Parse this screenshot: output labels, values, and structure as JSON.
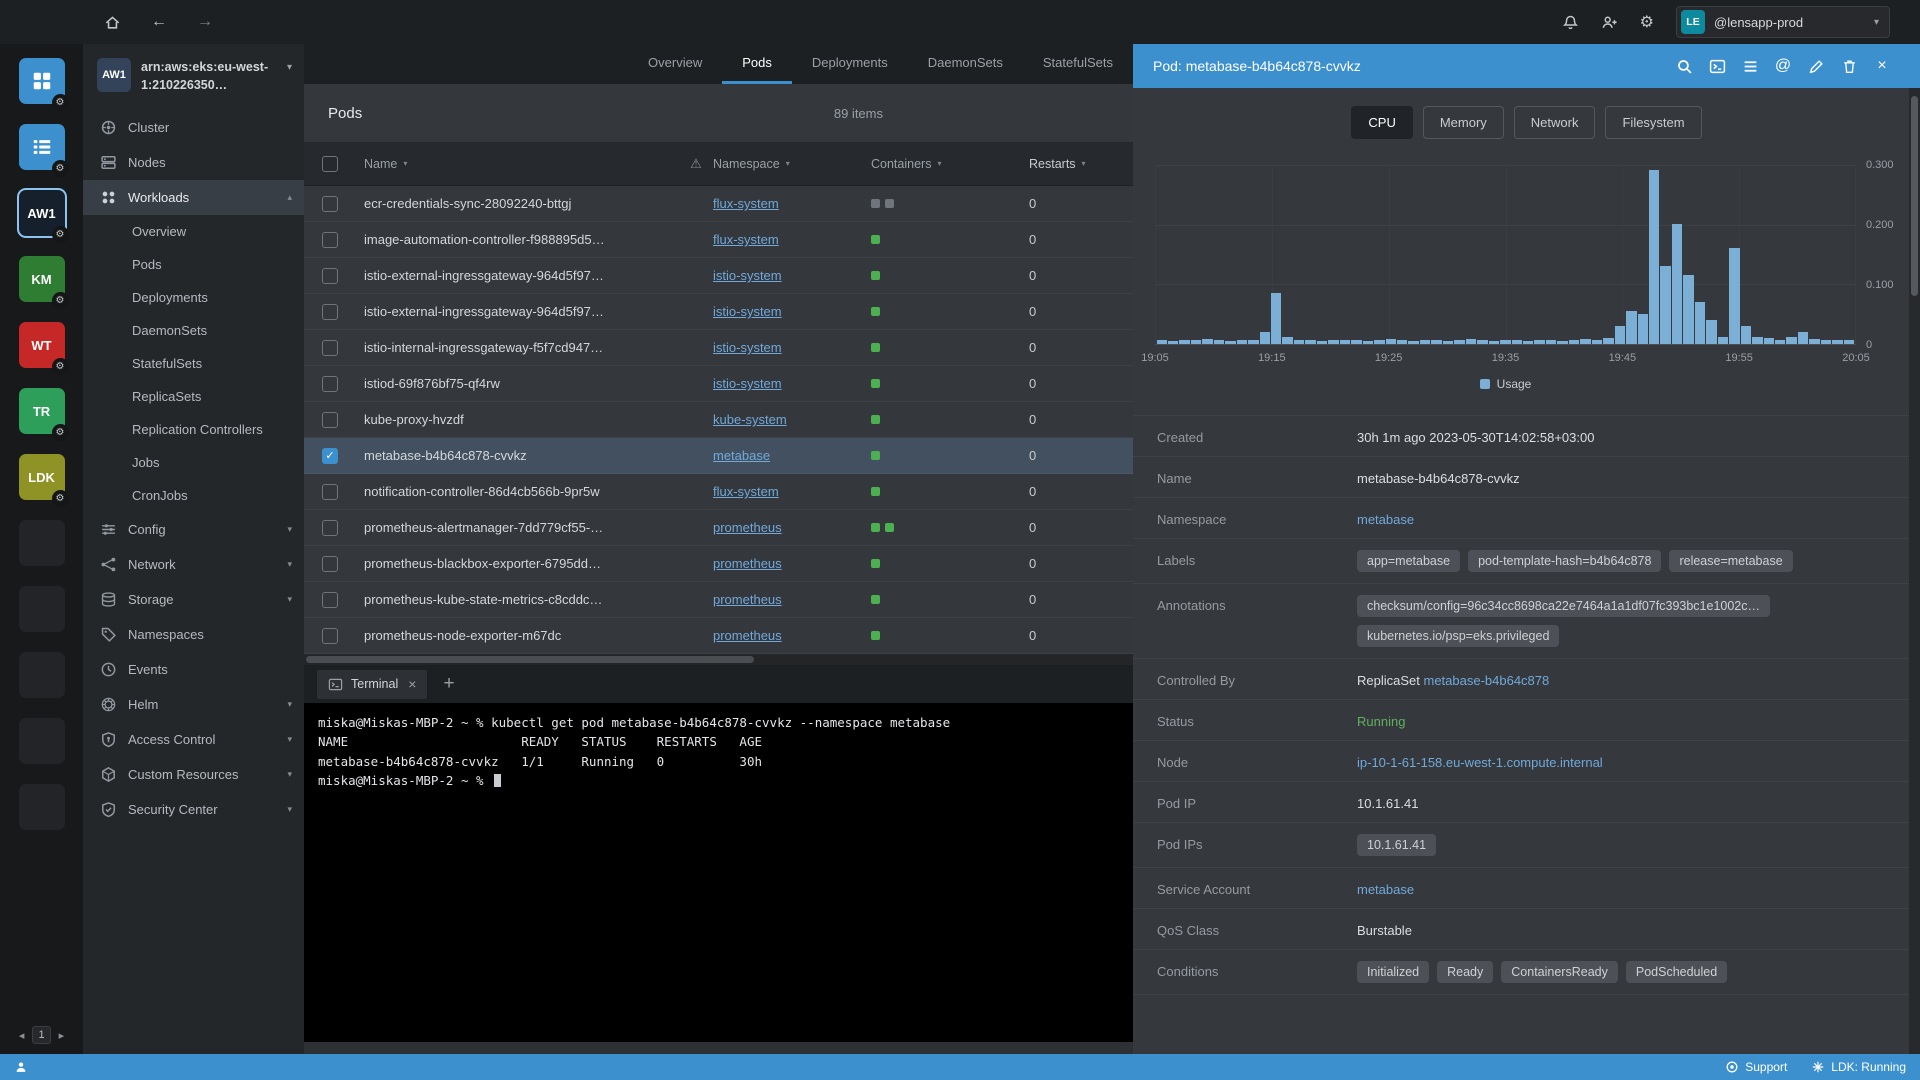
{
  "topbar": {
    "cluster_dropdown": {
      "avatar": "LE",
      "label": "@lensapp-prod"
    }
  },
  "hotbar": {
    "tiles": [
      {
        "id": "catalog",
        "icon": "catalog",
        "color": "#3d90ce"
      },
      {
        "id": "hotbar-menu",
        "icon": "list",
        "color": "#3d90ce"
      },
      {
        "id": "aw1",
        "label": "AW1",
        "color": "#15202c",
        "active": true
      },
      {
        "id": "km",
        "label": "KM",
        "color": "#2e7d32"
      },
      {
        "id": "wt",
        "label": "WT",
        "color": "#c62828"
      },
      {
        "id": "tr",
        "label": "TR",
        "color": "#2e9e5b"
      },
      {
        "id": "ldk",
        "label": "LDK",
        "color": "#8f9225"
      }
    ],
    "empty_slots": 5,
    "page": "1"
  },
  "sidebar": {
    "cluster": {
      "badge": "AW1",
      "name": "arn:aws:eks:eu-west-1:210226350…"
    },
    "active_child": "Pods",
    "items": [
      {
        "label": "Cluster",
        "icon": "cluster"
      },
      {
        "label": "Nodes",
        "icon": "nodes"
      },
      {
        "label": "Workloads",
        "icon": "workloads",
        "expanded": true,
        "active": true,
        "children": [
          "Overview",
          "Pods",
          "Deployments",
          "DaemonSets",
          "StatefulSets",
          "ReplicaSets",
          "Replication Controllers",
          "Jobs",
          "CronJobs"
        ]
      },
      {
        "label": "Config",
        "icon": "config",
        "expandable": true
      },
      {
        "label": "Network",
        "icon": "network",
        "expandable": true
      },
      {
        "label": "Storage",
        "icon": "storage",
        "expandable": true
      },
      {
        "label": "Namespaces",
        "icon": "namespaces"
      },
      {
        "label": "Events",
        "icon": "events"
      },
      {
        "label": "Helm",
        "icon": "helm",
        "expandable": true
      },
      {
        "label": "Access Control",
        "icon": "access",
        "expandable": true
      },
      {
        "label": "Custom Resources",
        "icon": "crd",
        "expandable": true
      },
      {
        "label": "Security Center",
        "icon": "security",
        "expandable": true
      }
    ]
  },
  "main": {
    "tabs": [
      "Overview",
      "Pods",
      "Deployments",
      "DaemonSets",
      "StatefulSets"
    ],
    "active_tab": "Pods",
    "list": {
      "title": "Pods",
      "count": "89 items",
      "columns": [
        "Name",
        "Namespace",
        "Containers",
        "Restarts"
      ],
      "rows": [
        {
          "name": "ecr-credentials-sync-28092240-bttgj",
          "namespace": "flux-system",
          "containers": [
            "terminated",
            "terminated"
          ],
          "restarts": "0"
        },
        {
          "name": "image-automation-controller-f988895d5…",
          "namespace": "flux-system",
          "containers": [
            "running"
          ],
          "restarts": "0"
        },
        {
          "name": "istio-external-ingressgateway-964d5f97…",
          "namespace": "istio-system",
          "containers": [
            "running"
          ],
          "restarts": "0"
        },
        {
          "name": "istio-external-ingressgateway-964d5f97…",
          "namespace": "istio-system",
          "containers": [
            "running"
          ],
          "restarts": "0"
        },
        {
          "name": "istio-internal-ingressgateway-f5f7cd947…",
          "namespace": "istio-system",
          "containers": [
            "running"
          ],
          "restarts": "0"
        },
        {
          "name": "istiod-69f876bf75-qf4rw",
          "namespace": "istio-system",
          "containers": [
            "running"
          ],
          "restarts": "0"
        },
        {
          "name": "kube-proxy-hvzdf",
          "namespace": "kube-system",
          "containers": [
            "running"
          ],
          "restarts": "0"
        },
        {
          "name": "metabase-b4b64c878-cvvkz",
          "namespace": "metabase",
          "containers": [
            "running"
          ],
          "restarts": "0",
          "checked": true,
          "selected": true
        },
        {
          "name": "notification-controller-86d4cb566b-9pr5w",
          "namespace": "flux-system",
          "containers": [
            "running"
          ],
          "restarts": "0"
        },
        {
          "name": "prometheus-alertmanager-7dd779cf55-…",
          "namespace": "prometheus",
          "containers": [
            "running",
            "running"
          ],
          "restarts": "0"
        },
        {
          "name": "prometheus-blackbox-exporter-6795dd…",
          "namespace": "prometheus",
          "containers": [
            "running"
          ],
          "restarts": "0"
        },
        {
          "name": "prometheus-kube-state-metrics-c8cddc…",
          "namespace": "prometheus",
          "containers": [
            "running"
          ],
          "restarts": "0"
        },
        {
          "name": "prometheus-node-exporter-m67dc",
          "namespace": "prometheus",
          "containers": [
            "running"
          ],
          "restarts": "0"
        }
      ]
    }
  },
  "dock": {
    "tab": "Terminal",
    "lines": "miska@Miskas-MBP-2 ~ % kubectl get pod metabase-b4b64c878-cvvkz --namespace metabase\nNAME                       READY   STATUS    RESTARTS   AGE\nmetabase-b4b64c878-cvvkz   1/1     Running   0          30h\nmiska@Miskas-MBP-2 ~ % "
  },
  "drawer": {
    "title": "Pod: metabase-b4b64c878-cvvkz",
    "tabs": [
      "CPU",
      "Memory",
      "Network",
      "Filesystem"
    ],
    "active_tab": "CPU",
    "fields": [
      {
        "label": "Created",
        "type": "text",
        "value": "30h 1m ago 2023-05-30T14:02:58+03:00"
      },
      {
        "label": "Name",
        "type": "text",
        "value": "metabase-b4b64c878-cvvkz"
      },
      {
        "label": "Namespace",
        "type": "link",
        "value": "metabase"
      },
      {
        "label": "Labels",
        "type": "chips",
        "values": [
          "app=metabase",
          "pod-template-hash=b4b64c878",
          "release=metabase"
        ]
      },
      {
        "label": "Annotations",
        "type": "chips-stacked",
        "values": [
          "checksum/config=96c34cc8698ca22e7464a1a1df07fc393bc1e1002c…",
          "kubernetes.io/psp=eks.privileged"
        ]
      },
      {
        "label": "Controlled By",
        "type": "text-link",
        "text": "ReplicaSet",
        "link": "metabase-b4b64c878"
      },
      {
        "label": "Status",
        "type": "status",
        "value": "Running"
      },
      {
        "label": "Node",
        "type": "link",
        "value": "ip-10-1-61-158.eu-west-1.compute.internal"
      },
      {
        "label": "Pod IP",
        "type": "text",
        "value": "10.1.61.41"
      },
      {
        "label": "Pod IPs",
        "type": "chips",
        "values": [
          "10.1.61.41"
        ]
      },
      {
        "label": "Service Account",
        "type": "link",
        "value": "metabase"
      },
      {
        "label": "QoS Class",
        "type": "text",
        "value": "Burstable"
      },
      {
        "label": "Conditions",
        "type": "chips",
        "values": [
          "Initialized",
          "Ready",
          "ContainersReady",
          "PodScheduled"
        ]
      }
    ]
  },
  "statusbar": {
    "support": "Support",
    "cluster_status": "LDK: Running"
  },
  "chart_data": {
    "type": "bar",
    "x_ticks": [
      "19:05",
      "19:15",
      "19:25",
      "19:35",
      "19:45",
      "19:55",
      "20:05"
    ],
    "y_tick_labels": [
      "0.300",
      "0.200",
      "0.100",
      "0"
    ],
    "ylim": [
      0,
      0.3
    ],
    "grid": true,
    "legend_position": "bottom",
    "series": [
      {
        "name": "Usage",
        "color": "#7bafd6",
        "values": [
          0.006,
          0.005,
          0.007,
          0.006,
          0.008,
          0.006,
          0.005,
          0.007,
          0.006,
          0.02,
          0.085,
          0.012,
          0.006,
          0.007,
          0.005,
          0.006,
          0.007,
          0.006,
          0.005,
          0.006,
          0.008,
          0.006,
          0.005,
          0.007,
          0.006,
          0.005,
          0.006,
          0.008,
          0.006,
          0.005,
          0.007,
          0.006,
          0.005,
          0.006,
          0.007,
          0.005,
          0.006,
          0.008,
          0.006,
          0.01,
          0.03,
          0.055,
          0.05,
          0.29,
          0.13,
          0.2,
          0.115,
          0.07,
          0.04,
          0.012,
          0.16,
          0.03,
          0.012,
          0.01,
          0.006,
          0.012,
          0.02,
          0.008,
          0.006,
          0.007,
          0.006
        ]
      }
    ]
  }
}
